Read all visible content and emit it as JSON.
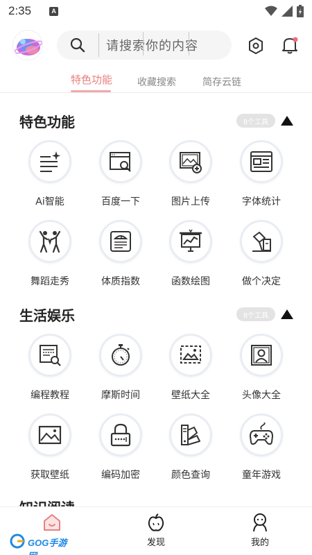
{
  "status": {
    "time": "2:35",
    "notif_letter": "A"
  },
  "search": {
    "placeholder": "请搜索你的内容"
  },
  "tabs": [
    {
      "label": "特色功能",
      "active": true
    },
    {
      "label": "收藏搜索",
      "active": false
    },
    {
      "label": "简存云链",
      "active": false
    }
  ],
  "sections": [
    {
      "title": "特色功能",
      "badge": "8个工具",
      "tools": [
        {
          "label": "Ai智能",
          "icon": "ai-sparkle-icon"
        },
        {
          "label": "百度一下",
          "icon": "browser-search-icon"
        },
        {
          "label": "图片上传",
          "icon": "image-upload-icon"
        },
        {
          "label": "字体统计",
          "icon": "font-stats-icon"
        },
        {
          "label": "舞蹈走秀",
          "icon": "dance-icon"
        },
        {
          "label": "体质指数",
          "icon": "scale-icon"
        },
        {
          "label": "函数绘图",
          "icon": "chart-board-icon"
        },
        {
          "label": "做个决定",
          "icon": "decision-icon"
        }
      ]
    },
    {
      "title": "生活娱乐",
      "badge": "8个工具",
      "tools": [
        {
          "label": "编程教程",
          "icon": "code-tutorial-icon"
        },
        {
          "label": "摩斯时间",
          "icon": "stopwatch-icon"
        },
        {
          "label": "壁纸大全",
          "icon": "wallpaper-icon"
        },
        {
          "label": "头像大全",
          "icon": "portrait-icon"
        },
        {
          "label": "获取壁纸",
          "icon": "picture-icon"
        },
        {
          "label": "编码加密",
          "icon": "lock-icon"
        },
        {
          "label": "颜色查询",
          "icon": "color-swatch-icon"
        },
        {
          "label": "童年游戏",
          "icon": "gamepad-icon"
        }
      ]
    }
  ],
  "partial_section": {
    "title": "知识阅读"
  },
  "bottom_nav": [
    {
      "label": "",
      "icon": "home-icon"
    },
    {
      "label": "发现",
      "icon": "apple-icon"
    },
    {
      "label": "我的",
      "icon": "profile-icon"
    }
  ],
  "watermark": {
    "text": "GOG手游网"
  },
  "colors": {
    "accent": "#e98080",
    "tab_underline": "#f1a9a9",
    "badge_bg": "#e3e3e3",
    "circle_border": "#e9edf3"
  }
}
